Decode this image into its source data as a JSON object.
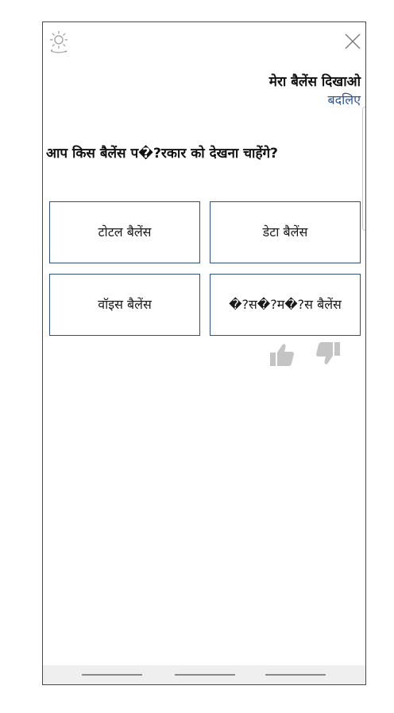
{
  "header": {
    "theme_icon": "brightness-icon",
    "close_icon": "close-icon"
  },
  "chat": {
    "user_message": "मेरा बैलेंस दिखाओ",
    "change_link": "बदलिए",
    "bot_question": "आप किस बैलेंस प�?रकार को देखना चाहेंगे?",
    "options": [
      "टोटल बैलेंस",
      "डेटा बैलेंस",
      "वॉइस बैलेंस",
      "�?स�?म�?स बैलेंस"
    ],
    "feedback": {
      "like_icon": "thumbs-up-icon",
      "dislike_icon": "thumbs-down-icon"
    }
  },
  "colors": {
    "link": "#2f5496",
    "option_border": "#2f4f7f",
    "feedback_icon": "#c4c4c4"
  }
}
